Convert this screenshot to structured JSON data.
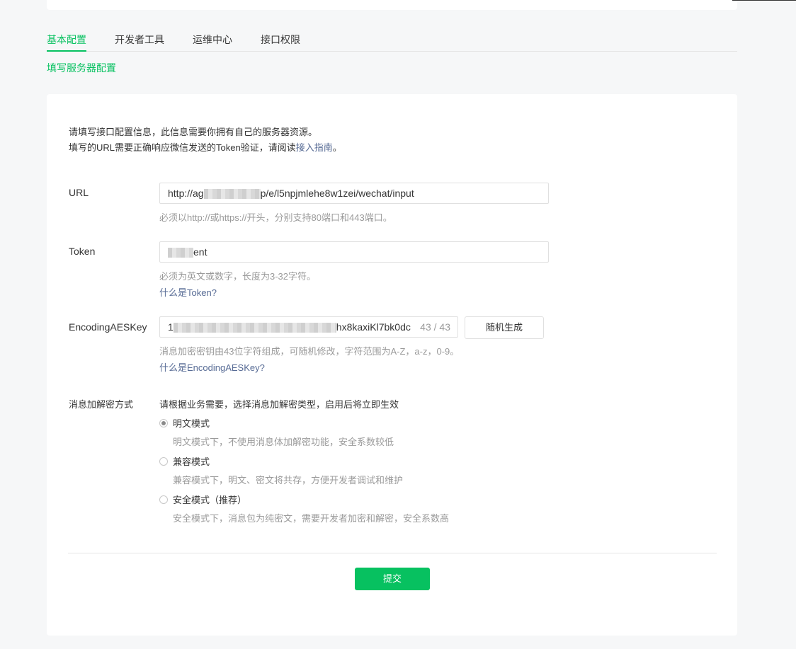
{
  "tabs": [
    "基本配置",
    "开发者工具",
    "运维中心",
    "接口权限"
  ],
  "subtitle": "填写服务器配置",
  "intro": {
    "line1": "请填写接口配置信息，此信息需要你拥有自己的服务器资源。",
    "line2_prefix": "填写的URL需要正确响应微信发送的Token验证，请阅读",
    "line2_link": "接入指南",
    "line2_suffix": "。"
  },
  "url": {
    "label": "URL",
    "value_start": "http://ag",
    "value_end": "p/e/l5npjmlehe8w1zei/wechat/input",
    "hint": "必须以http://或https://开头，分别支持80端口和443端口。"
  },
  "token": {
    "label": "Token",
    "value_end": "ent",
    "hint": "必须为英文或数字，长度为3-32字符。",
    "help_link": "什么是Token?"
  },
  "aes": {
    "label": "EncodingAESKey",
    "value_start": "1",
    "value_end": "hx8kaxiKl7bk0dc",
    "count": "43 / 43",
    "random_button": "随机生成",
    "hint": "消息加密密钥由43位字符组成，可随机修改，字符范围为A-Z，a-z，0-9。",
    "help_link": "什么是EncodingAESKey?"
  },
  "encryption": {
    "label": "消息加解密方式",
    "prompt": "请根据业务需要，选择消息加解密类型，启用后将立即生效",
    "options": [
      {
        "label": "明文模式",
        "desc": "明文模式下，不使用消息体加解密功能，安全系数较低",
        "checked": true
      },
      {
        "label": "兼容模式",
        "desc": "兼容模式下，明文、密文将共存，方便开发者调试和维护",
        "checked": false
      },
      {
        "label": "安全模式（推荐）",
        "desc": "安全模式下，消息包为纯密文，需要开发者加密和解密，安全系数高",
        "checked": false
      }
    ]
  },
  "submit_label": "提交",
  "colors": {
    "accent": "#07c160",
    "link": "#576b95",
    "hint": "#9a9a9a"
  }
}
